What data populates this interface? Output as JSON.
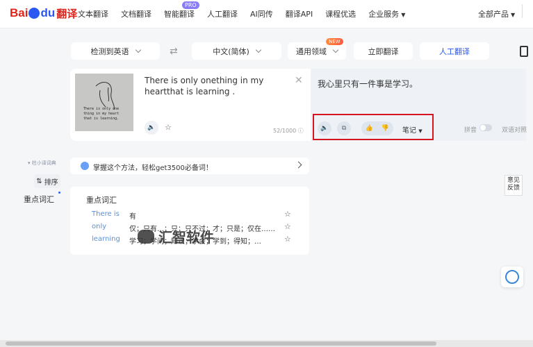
{
  "brand": {
    "logo_prefix": "Bai",
    "logo_suffix": "du",
    "logo_product": "翻译"
  },
  "nav": {
    "items": [
      "文本翻译",
      "文档翻译",
      "智能翻译",
      "人工翻译",
      "AI同传",
      "翻译API",
      "课程优选",
      "企业服务"
    ],
    "pro_badge": "PRO",
    "all_products": "全部产品"
  },
  "toolbar": {
    "source_lang": "检测到英语",
    "target_lang": "中文(简体)",
    "domain": "通用领域",
    "new_badge": "NEW",
    "translate": "立即翻译",
    "human": "人工翻译"
  },
  "source": {
    "text": "There is only onething in my heartthat is learning .",
    "image_text": "There is only one\nthing in my heart\nthat is learning.",
    "count": "52/1000"
  },
  "target": {
    "text": "我心里只有一件事是学习。",
    "notes": "笔记",
    "pinyin": "拼音",
    "bilingual": "双语对照"
  },
  "side": {
    "dict_label": "柱小译词典",
    "sort": "排序",
    "keyword": "重点词汇"
  },
  "banner": {
    "text": "掌握这个方法，轻松get3500必备词！"
  },
  "vocab": {
    "title": "重点词汇",
    "rows": [
      {
        "word": "There is",
        "meaning": "有"
      },
      {
        "word": "only",
        "meaning": "仅；只有…；只；只不过；才；只是；仅在……"
      },
      {
        "word": "learning",
        "meaning": "学习；学问；知识；学会；学到；得知；…"
      }
    ]
  },
  "watermark": {
    "text": "汇智软件"
  },
  "feedback": {
    "text": "意见反馈"
  },
  "colors": {
    "brand_blue": "#2b58f0",
    "brand_red": "#e2231a",
    "highlight": "#d6141f"
  }
}
